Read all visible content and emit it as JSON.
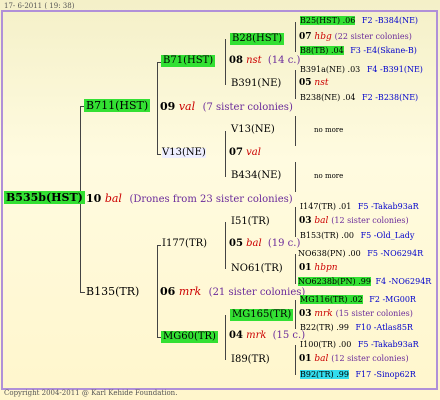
{
  "header": {
    "date": "17-  6-2011 ( 19: 38)"
  },
  "footer": {
    "copyright": "Copyright 2004-2011 @ Karl Kehide Foundation."
  },
  "root": {
    "code": "B535b(HST)"
  },
  "gen1": {
    "year": "10",
    "name": "bal",
    "note": "(Drones from 23 sister colonies)"
  },
  "m1": {
    "code": "B711(HST)",
    "year": "09",
    "name": "val",
    "note": "(7 sister colonies)"
  },
  "m1a": {
    "code": "B71(HST)",
    "year": "08",
    "name": "nst",
    "note": "(14 c.)"
  },
  "m1b": {
    "code": "V13(NE)",
    "year": "07",
    "name": "val"
  },
  "m1a1": {
    "code": "B28(HST)",
    "year": "07",
    "name": "hbg",
    "note": "(22 sister colonies)"
  },
  "m1a2": {
    "code": "B391(NE)",
    "year": "05",
    "name": "nst"
  },
  "m1b1": {
    "code": "V13(NE)"
  },
  "m1b2": {
    "code": "B434(NE)"
  },
  "more": "no more",
  "rows": {
    "r1": {
      "a": "B25(HST) .06",
      "b": "F2 -B384(NE)"
    },
    "r2": {
      "a": "B8(TB) .04",
      "b": "F3 -E4(Skane-B)"
    },
    "r3": {
      "a": "B391a(NE) .03",
      "b": "F4 -B391(NE)"
    },
    "r4": {
      "a": "B238(NE) .04",
      "b": "F2 -B238(NE)"
    },
    "r5": {
      "a": "I147(TR) .01",
      "b": "F5 -Takab93aR"
    },
    "r6": {
      "a": "B153(TR) .00",
      "b": "F5 -Old_Lady"
    },
    "r7": {
      "a": "NO638(PN) .00",
      "b": "F5 -NO6294R"
    },
    "r8": {
      "a": "NO6238b(PN) .99",
      "b": "F4 -NO6294R"
    },
    "r9": {
      "a": "MG116(TR) .02",
      "b": "F2 -MG00R"
    },
    "r10": {
      "a": "B22(TR) .99",
      "b": "F10 -Atlas85R"
    },
    "r11": {
      "a": "I100(TR) .00",
      "b": "F5 -Takab93aR"
    },
    "r12": {
      "a": "B92(TR) .99",
      "b": "F17 -Sinop62R"
    }
  },
  "f1": {
    "code": "B135(TR)",
    "year": "06",
    "name": "mrk",
    "note": "(21 sister colonies)"
  },
  "f1a": {
    "code": "I177(TR)",
    "year": "05",
    "name": "bal",
    "note": "(19 c.)"
  },
  "f1b": {
    "code": "MG60(TR)",
    "year": "04",
    "name": "mrk",
    "note": "(15 c.)"
  },
  "f1a1": {
    "code": "I51(TR)",
    "year": "03",
    "name": "bal",
    "note": "(12 sister colonies)"
  },
  "f1a2": {
    "code": "NO61(TR)",
    "year": "01",
    "name": "hbpn"
  },
  "f1b1": {
    "code": "MG165(TR)",
    "year": "03",
    "name": "mrk",
    "note": "(15 sister colonies)"
  },
  "f1b2": {
    "code": "I89(TR)",
    "year": "01",
    "name": "bal",
    "note": "(12 sister colonies)"
  }
}
